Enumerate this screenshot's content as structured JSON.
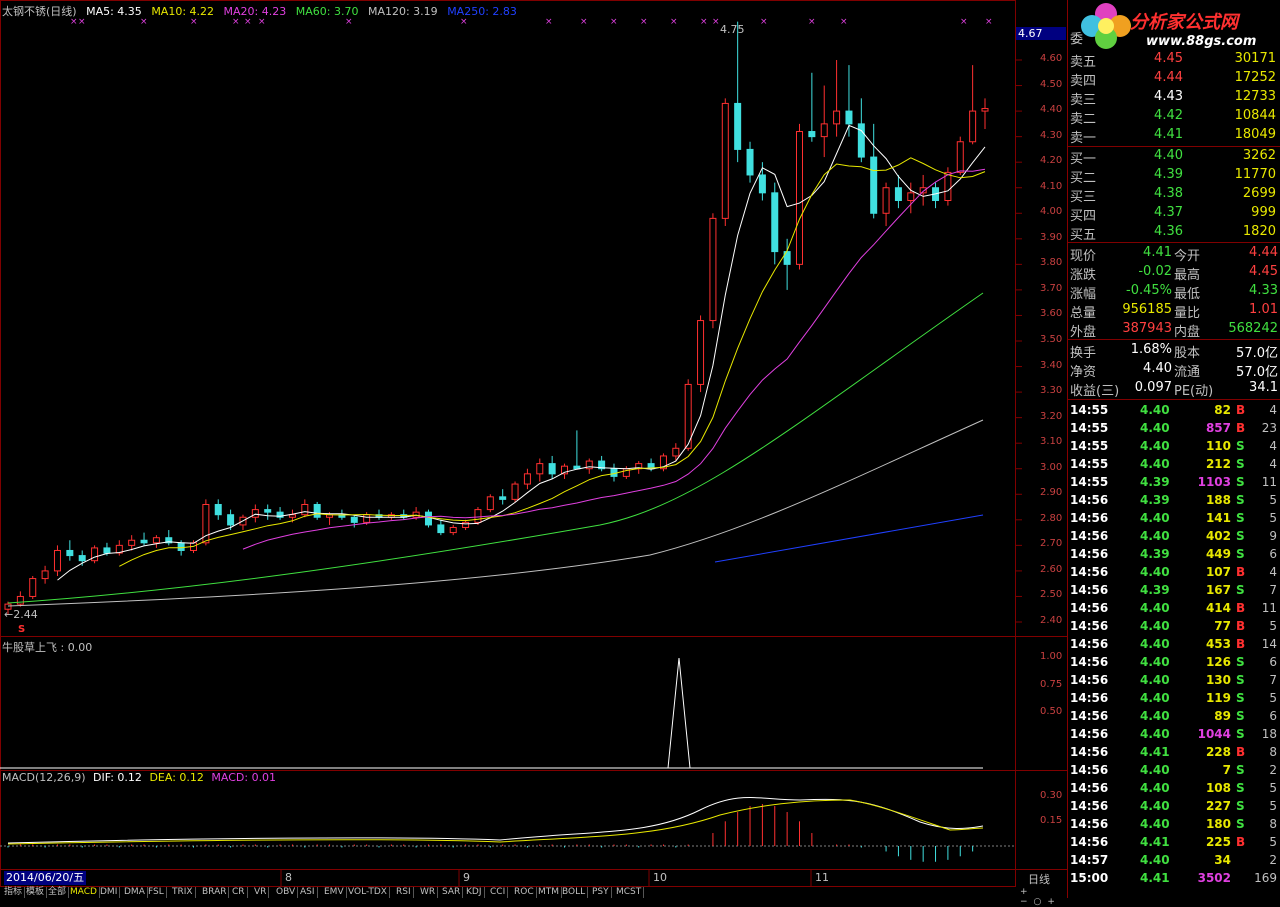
{
  "header": {
    "stock_name": "太钢不锈(日线)",
    "ma": [
      {
        "label": "MA5: 4.35",
        "color": "#ffffff"
      },
      {
        "label": "MA10: 4.22",
        "color": "#e8e800"
      },
      {
        "label": "MA20: 4.23",
        "color": "#e040e0"
      },
      {
        "label": "MA60: 3.70",
        "color": "#40e040"
      },
      {
        "label": "MA120: 3.19",
        "color": "#c0c0c0"
      },
      {
        "label": "MA250: 2.83",
        "color": "#2040ff"
      }
    ]
  },
  "price_axis": {
    "ticks": [
      "4.60",
      "4.50",
      "4.40",
      "4.30",
      "4.20",
      "4.10",
      "4.00",
      "3.90",
      "3.80",
      "3.70",
      "3.60",
      "3.50",
      "3.40",
      "3.30",
      "3.20",
      "3.10",
      "3.00",
      "2.90",
      "2.80",
      "2.70",
      "2.60",
      "2.50",
      "2.40"
    ],
    "current_price_box": "4.67",
    "high_label": "4.75",
    "low_label": "2.44",
    "marker_s": "S"
  },
  "indicator1": {
    "title": "牛股草上飞 : 0.00",
    "ticks": [
      "1.00",
      "0.75",
      "0.50"
    ]
  },
  "macd": {
    "title": "MACD(12,26,9)",
    "dif": "DIF: 0.12",
    "dea": "DEA: 0.12",
    "macd": "MACD: 0.01",
    "ticks": [
      "0.30",
      "0.15"
    ]
  },
  "date_axis": {
    "current_date": "2014/06/20/五",
    "months": [
      "8",
      "9",
      "10",
      "11"
    ],
    "period": "日线"
  },
  "bottom_tabs": [
    "指标",
    "模板",
    "全部",
    "MACD",
    "DMI",
    "DMA",
    "FSL",
    "TRIX",
    "BRAR",
    "CR",
    "VR",
    "OBV",
    "ASI",
    "EMV",
    "VOL-TDX",
    "RSI",
    "WR",
    "SAR",
    "KDJ",
    "CCI",
    "ROC",
    "MTM",
    "BOLL",
    "PSY",
    "MCST"
  ],
  "logo": {
    "text": "分析家公式网",
    "url": "www.88gs.com"
  },
  "order_book": {
    "title": "委",
    "sell": [
      {
        "label": "卖五",
        "price": "4.45",
        "vol": "30171",
        "color": "#ff4040"
      },
      {
        "label": "卖四",
        "price": "4.44",
        "vol": "17252",
        "color": "#ff4040"
      },
      {
        "label": "卖三",
        "price": "4.43",
        "vol": "12733",
        "color": "#ffffff"
      },
      {
        "label": "卖二",
        "price": "4.42",
        "vol": "10844",
        "color": "#40e040"
      },
      {
        "label": "卖一",
        "price": "4.41",
        "vol": "18049",
        "color": "#40e040"
      }
    ],
    "buy": [
      {
        "label": "买一",
        "price": "4.40",
        "vol": "3262",
        "color": "#40e040"
      },
      {
        "label": "买二",
        "price": "4.39",
        "vol": "11770",
        "color": "#40e040"
      },
      {
        "label": "买三",
        "price": "4.38",
        "vol": "2699",
        "color": "#40e040"
      },
      {
        "label": "买四",
        "price": "4.37",
        "vol": "999",
        "color": "#40e040"
      },
      {
        "label": "买五",
        "price": "4.36",
        "vol": "1820",
        "color": "#40e040"
      }
    ]
  },
  "stats": [
    {
      "l1": "现价",
      "v1": "4.41",
      "c1": "#40e040",
      "l2": "今开",
      "v2": "4.44",
      "c2": "#ff4040"
    },
    {
      "l1": "涨跌",
      "v1": "-0.02",
      "c1": "#40e040",
      "l2": "最高",
      "v2": "4.45",
      "c2": "#ff4040"
    },
    {
      "l1": "涨幅",
      "v1": "-0.45%",
      "c1": "#40e040",
      "l2": "最低",
      "v2": "4.33",
      "c2": "#40e040"
    },
    {
      "l1": "总量",
      "v1": "956185",
      "c1": "#e8e800",
      "l2": "量比",
      "v2": "1.01",
      "c2": "#ff4040"
    },
    {
      "l1": "外盘",
      "v1": "387943",
      "c1": "#ff4040",
      "l2": "内盘",
      "v2": "568242",
      "c2": "#40e040"
    },
    {
      "l1": "换手",
      "v1": "1.68%",
      "c1": "#ffffff",
      "l2": "股本",
      "v2": "57.0亿",
      "c2": "#ffffff"
    },
    {
      "l1": "净资",
      "v1": "4.40",
      "c1": "#ffffff",
      "l2": "流通",
      "v2": "57.0亿",
      "c2": "#ffffff"
    },
    {
      "l1": "收益(三)",
      "v1": "0.097",
      "c1": "#ffffff",
      "l2": "PE(动)",
      "v2": "34.1",
      "c2": "#ffffff"
    }
  ],
  "ticks": [
    {
      "t": "14:55",
      "p": "4.40",
      "v": "82",
      "bs": "B",
      "n": "4"
    },
    {
      "t": "14:55",
      "p": "4.40",
      "v": "857",
      "bs": "B",
      "n": "23"
    },
    {
      "t": "14:55",
      "p": "4.40",
      "v": "110",
      "bs": "S",
      "n": "4"
    },
    {
      "t": "14:55",
      "p": "4.40",
      "v": "212",
      "bs": "S",
      "n": "4"
    },
    {
      "t": "14:55",
      "p": "4.39",
      "v": "1103",
      "bs": "S",
      "n": "11"
    },
    {
      "t": "14:56",
      "p": "4.39",
      "v": "188",
      "bs": "S",
      "n": "5"
    },
    {
      "t": "14:56",
      "p": "4.40",
      "v": "141",
      "bs": "S",
      "n": "5"
    },
    {
      "t": "14:56",
      "p": "4.40",
      "v": "402",
      "bs": "S",
      "n": "9"
    },
    {
      "t": "14:56",
      "p": "4.39",
      "v": "449",
      "bs": "S",
      "n": "6"
    },
    {
      "t": "14:56",
      "p": "4.40",
      "v": "107",
      "bs": "B",
      "n": "4"
    },
    {
      "t": "14:56",
      "p": "4.39",
      "v": "167",
      "bs": "S",
      "n": "7"
    },
    {
      "t": "14:56",
      "p": "4.40",
      "v": "414",
      "bs": "B",
      "n": "11"
    },
    {
      "t": "14:56",
      "p": "4.40",
      "v": "77",
      "bs": "B",
      "n": "5"
    },
    {
      "t": "14:56",
      "p": "4.40",
      "v": "453",
      "bs": "B",
      "n": "14"
    },
    {
      "t": "14:56",
      "p": "4.40",
      "v": "126",
      "bs": "S",
      "n": "6"
    },
    {
      "t": "14:56",
      "p": "4.40",
      "v": "130",
      "bs": "S",
      "n": "7"
    },
    {
      "t": "14:56",
      "p": "4.40",
      "v": "119",
      "bs": "S",
      "n": "5"
    },
    {
      "t": "14:56",
      "p": "4.40",
      "v": "89",
      "bs": "S",
      "n": "6"
    },
    {
      "t": "14:56",
      "p": "4.40",
      "v": "1044",
      "bs": "S",
      "n": "18"
    },
    {
      "t": "14:56",
      "p": "4.41",
      "v": "228",
      "bs": "B",
      "n": "8"
    },
    {
      "t": "14:56",
      "p": "4.40",
      "v": "7",
      "bs": "S",
      "n": "2"
    },
    {
      "t": "14:56",
      "p": "4.40",
      "v": "108",
      "bs": "S",
      "n": "5"
    },
    {
      "t": "14:56",
      "p": "4.40",
      "v": "227",
      "bs": "S",
      "n": "5"
    },
    {
      "t": "14:56",
      "p": "4.40",
      "v": "180",
      "bs": "S",
      "n": "8"
    },
    {
      "t": "14:56",
      "p": "4.41",
      "v": "225",
      "bs": "B",
      "n": "5"
    },
    {
      "t": "14:57",
      "p": "4.40",
      "v": "34",
      "bs": "",
      "n": "2"
    },
    {
      "t": "15:00",
      "p": "4.41",
      "v": "3502",
      "bs": "",
      "n": "169"
    }
  ],
  "chart_data": {
    "type": "candlestick",
    "title": "太钢不锈(日线)",
    "price_range": [
      2.4,
      4.75
    ],
    "series_summary": {
      "start_price": 2.44,
      "high": 4.75,
      "last_close": 4.41
    },
    "candles_approx": [
      [
        2.45,
        2.48,
        2.43,
        2.47
      ],
      [
        2.47,
        2.52,
        2.46,
        2.5
      ],
      [
        2.5,
        2.58,
        2.49,
        2.57
      ],
      [
        2.57,
        2.62,
        2.55,
        2.6
      ],
      [
        2.6,
        2.7,
        2.58,
        2.68
      ],
      [
        2.68,
        2.72,
        2.64,
        2.66
      ],
      [
        2.66,
        2.68,
        2.62,
        2.64
      ],
      [
        2.64,
        2.7,
        2.63,
        2.69
      ],
      [
        2.69,
        2.71,
        2.66,
        2.67
      ],
      [
        2.67,
        2.72,
        2.66,
        2.7
      ],
      [
        2.7,
        2.74,
        2.68,
        2.72
      ],
      [
        2.72,
        2.75,
        2.7,
        2.71
      ],
      [
        2.71,
        2.74,
        2.69,
        2.73
      ],
      [
        2.73,
        2.76,
        2.7,
        2.71
      ],
      [
        2.71,
        2.72,
        2.66,
        2.68
      ],
      [
        2.68,
        2.72,
        2.67,
        2.71
      ],
      [
        2.71,
        2.88,
        2.7,
        2.86
      ],
      [
        2.86,
        2.88,
        2.8,
        2.82
      ],
      [
        2.82,
        2.84,
        2.76,
        2.78
      ],
      [
        2.78,
        2.82,
        2.76,
        2.81
      ],
      [
        2.81,
        2.86,
        2.79,
        2.84
      ],
      [
        2.84,
        2.86,
        2.8,
        2.83
      ],
      [
        2.83,
        2.85,
        2.8,
        2.81
      ],
      [
        2.81,
        2.84,
        2.79,
        2.82
      ],
      [
        2.82,
        2.88,
        2.81,
        2.86
      ],
      [
        2.86,
        2.87,
        2.8,
        2.81
      ],
      [
        2.81,
        2.83,
        2.78,
        2.82
      ],
      [
        2.82,
        2.84,
        2.8,
        2.81
      ],
      [
        2.81,
        2.82,
        2.77,
        2.79
      ],
      [
        2.79,
        2.83,
        2.78,
        2.82
      ],
      [
        2.82,
        2.84,
        2.8,
        2.81
      ],
      [
        2.81,
        2.83,
        2.8,
        2.82
      ],
      [
        2.82,
        2.84,
        2.8,
        2.81
      ],
      [
        2.81,
        2.85,
        2.8,
        2.83
      ],
      [
        2.83,
        2.84,
        2.77,
        2.78
      ],
      [
        2.78,
        2.8,
        2.74,
        2.75
      ],
      [
        2.75,
        2.78,
        2.74,
        2.77
      ],
      [
        2.77,
        2.8,
        2.76,
        2.79
      ],
      [
        2.79,
        2.85,
        2.78,
        2.84
      ],
      [
        2.84,
        2.9,
        2.83,
        2.89
      ],
      [
        2.89,
        2.92,
        2.86,
        2.88
      ],
      [
        2.88,
        2.95,
        2.87,
        2.94
      ],
      [
        2.94,
        3.0,
        2.92,
        2.98
      ],
      [
        2.98,
        3.04,
        2.95,
        3.02
      ],
      [
        3.02,
        3.05,
        2.96,
        2.98
      ],
      [
        2.98,
        3.02,
        2.96,
        3.01
      ],
      [
        3.01,
        3.15,
        3.0,
        3.0
      ],
      [
        3.0,
        3.04,
        2.98,
        3.03
      ],
      [
        3.03,
        3.05,
        2.99,
        3.0
      ],
      [
        3.0,
        3.02,
        2.95,
        2.97
      ],
      [
        2.97,
        3.01,
        2.96,
        3.0
      ],
      [
        3.0,
        3.03,
        2.98,
        3.02
      ],
      [
        3.02,
        3.04,
        2.99,
        3.0
      ],
      [
        3.0,
        3.06,
        2.99,
        3.05
      ],
      [
        3.05,
        3.1,
        3.03,
        3.08
      ],
      [
        3.08,
        3.35,
        3.07,
        3.33
      ],
      [
        3.33,
        3.6,
        3.3,
        3.58
      ],
      [
        3.58,
        4.0,
        3.55,
        3.98
      ],
      [
        3.98,
        4.45,
        3.95,
        4.43
      ],
      [
        4.43,
        4.75,
        4.2,
        4.25
      ],
      [
        4.25,
        4.28,
        4.12,
        4.15
      ],
      [
        4.15,
        4.2,
        4.05,
        4.08
      ],
      [
        4.08,
        4.12,
        3.8,
        3.85
      ],
      [
        3.85,
        3.9,
        3.7,
        3.8
      ],
      [
        3.8,
        4.35,
        3.78,
        4.32
      ],
      [
        4.32,
        4.55,
        4.28,
        4.3
      ],
      [
        4.3,
        4.5,
        4.22,
        4.35
      ],
      [
        4.35,
        4.6,
        4.3,
        4.4
      ],
      [
        4.4,
        4.58,
        4.3,
        4.35
      ],
      [
        4.35,
        4.45,
        4.2,
        4.22
      ],
      [
        4.22,
        4.35,
        3.98,
        4.0
      ],
      [
        4.0,
        4.12,
        3.95,
        4.1
      ],
      [
        4.1,
        4.15,
        4.02,
        4.05
      ],
      [
        4.05,
        4.12,
        4.0,
        4.08
      ],
      [
        4.08,
        4.15,
        4.03,
        4.1
      ],
      [
        4.1,
        4.12,
        4.02,
        4.05
      ],
      [
        4.05,
        4.18,
        4.03,
        4.16
      ],
      [
        4.16,
        4.3,
        4.15,
        4.28
      ],
      [
        4.28,
        4.58,
        4.27,
        4.4
      ],
      [
        4.4,
        4.45,
        4.33,
        4.41
      ]
    ]
  }
}
